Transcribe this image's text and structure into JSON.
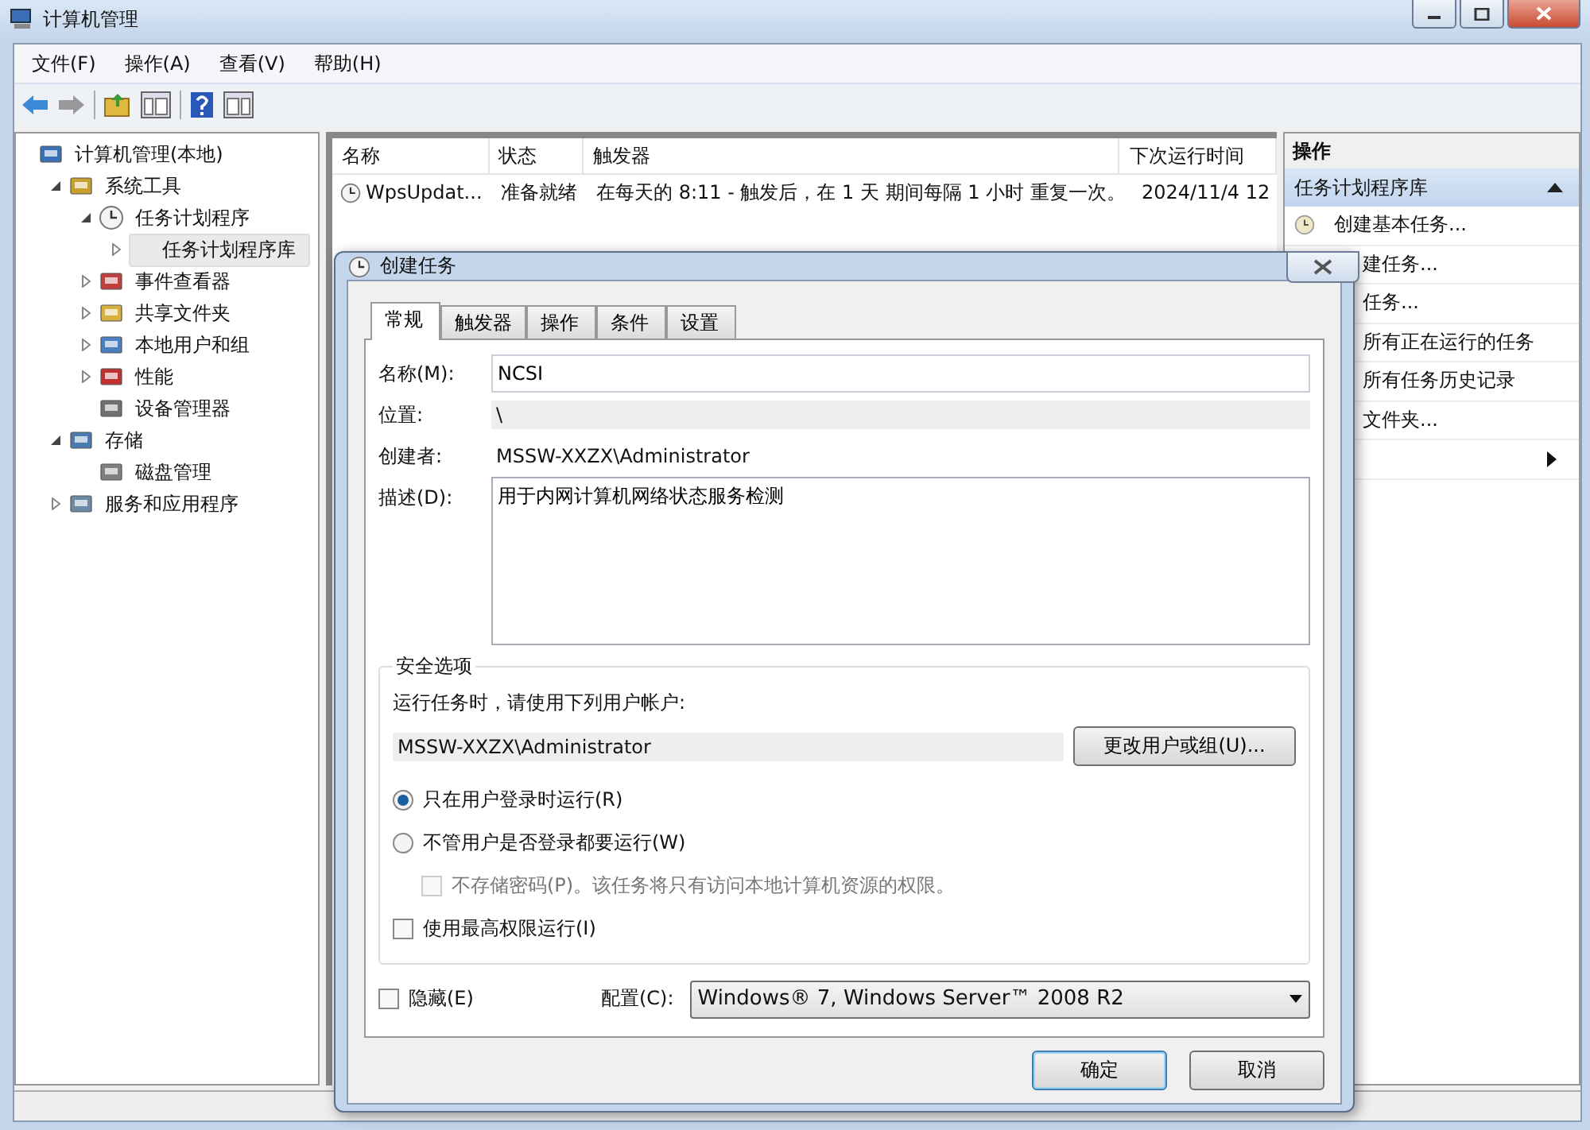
{
  "window": {
    "title": "计算机管理"
  },
  "menu": [
    "文件(F)",
    "操作(A)",
    "查看(V)",
    "帮助(H)"
  ],
  "tree": [
    {
      "label": "计算机管理(本地)",
      "selected": false,
      "children": [
        {
          "label": "系统工具",
          "expanded": true,
          "selected": false,
          "children": [
            {
              "label": "任务计划程序",
              "expanded": true,
              "selected": false,
              "children": [
                {
                  "label": "任务计划程序库",
                  "expanded": false,
                  "selected": true
                }
              ]
            },
            {
              "label": "事件查看器",
              "expanded": false,
              "selected": false
            },
            {
              "label": "共享文件夹",
              "expanded": false,
              "selected": false
            },
            {
              "label": "本地用户和组",
              "expanded": false,
              "selected": false
            },
            {
              "label": "性能",
              "expanded": false,
              "selected": false
            },
            {
              "label": "设备管理器",
              "selected": false
            }
          ]
        },
        {
          "label": "存储",
          "expanded": true,
          "selected": false,
          "children": [
            {
              "label": "磁盘管理",
              "selected": false
            }
          ]
        },
        {
          "label": "服务和应用程序",
          "expanded": false,
          "selected": false
        }
      ]
    }
  ],
  "list": {
    "columns": [
      "名称",
      "状态",
      "触发器",
      "下次运行时间"
    ],
    "rows": [
      [
        "WpsUpdat...",
        "准备就绪",
        "在每天的 8:11 - 触发后，在 1 天 期间每隔 1 小时 重复一次。",
        "2024/11/4 12"
      ]
    ]
  },
  "actions": {
    "header": "操作",
    "section": {
      "title": "任务计划程序库",
      "expanded": true
    },
    "items": [
      {
        "text": "创建基本任务...",
        "kind": "full"
      },
      {
        "text": "建任务...",
        "kind": "cut"
      },
      {
        "text": "任务...",
        "kind": "cut"
      },
      {
        "text": "所有正在运行的任务",
        "kind": "cut"
      },
      {
        "text": "所有任务历史记录",
        "kind": "cut"
      },
      {
        "text": "文件夹...",
        "kind": "cut"
      },
      {
        "kind": "submenu"
      }
    ]
  },
  "dialog": {
    "title": "创建任务",
    "tabs": [
      {
        "label": "常规",
        "selected": true
      },
      {
        "label": "触发器",
        "selected": false
      },
      {
        "label": "操作",
        "selected": false
      },
      {
        "label": "条件",
        "selected": false
      },
      {
        "label": "设置",
        "selected": false
      }
    ],
    "name": {
      "label": "名称(M):",
      "value": "NCSI"
    },
    "location": {
      "label": "位置:",
      "value": "\\"
    },
    "author": {
      "label": "创建者:",
      "value": "MSSW-XXZX\\Administrator"
    },
    "description": {
      "label": "描述(D):",
      "value": "用于内网计算机网络状态服务检测"
    },
    "security": {
      "title": "安全选项",
      "prompt": "运行任务时，请使用下列用户帐户:",
      "user": "MSSW-XXZX\\Administrator",
      "change_button": "更改用户或组(U)...",
      "radios": [
        {
          "label": "只在用户登录时运行(R)",
          "selected": true
        },
        {
          "label": "不管用户是否登录都要运行(W)",
          "selected": false
        }
      ],
      "no_password": {
        "label": "不存储密码(P)。该任务将只有访问本地计算机资源的权限。",
        "checked": false,
        "disabled": true
      },
      "highest": {
        "label": "使用最高权限运行(I)",
        "checked": false
      }
    },
    "hidden": {
      "label": "隐藏(E)",
      "checked": false
    },
    "config": {
      "label": "配置(C):",
      "value": "Windows® 7, Windows Server™ 2008 R2"
    },
    "buttons": [
      "确定",
      "取消"
    ]
  }
}
